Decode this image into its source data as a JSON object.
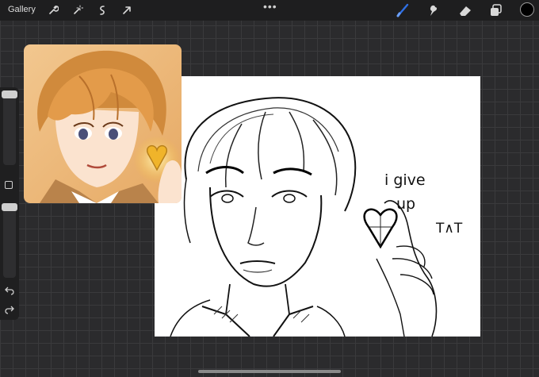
{
  "toolbar": {
    "gallery_label": "Gallery",
    "left_tools": [
      {
        "icon": "wrench-icon"
      },
      {
        "icon": "magic-wand-icon"
      },
      {
        "icon": "selection-icon"
      },
      {
        "icon": "transform-arrow-icon"
      }
    ],
    "more_label": "•••",
    "right_tools": [
      {
        "icon": "brush-icon",
        "active": true
      },
      {
        "icon": "smudge-icon"
      },
      {
        "icon": "eraser-icon"
      },
      {
        "icon": "layers-icon"
      }
    ],
    "current_color": "#000000",
    "accent": "#2f6fe4"
  },
  "sidebar": {
    "undo_icon": "undo-icon",
    "redo_icon": "redo-icon",
    "modify_icon": "modify-square-icon"
  },
  "canvas": {
    "caption": {
      "line1": "i give",
      "line2": "up",
      "line3": "T∧T"
    }
  }
}
